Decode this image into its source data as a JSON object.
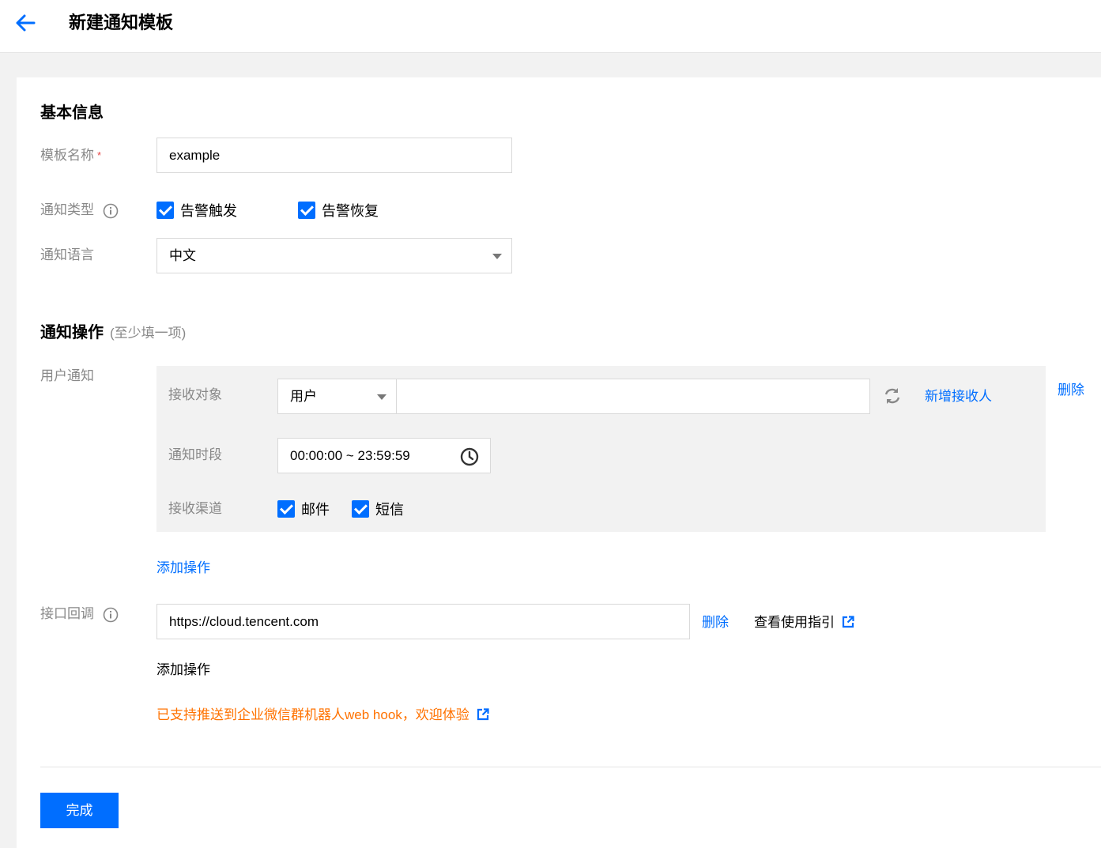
{
  "header": {
    "title": "新建通知模板"
  },
  "basic": {
    "section_title": "基本信息",
    "template_name_label": "模板名称",
    "required_mark": "*",
    "template_name_value": "example",
    "notify_type_label": "通知类型",
    "notify_types": [
      {
        "label": "告警触发",
        "checked": true
      },
      {
        "label": "告警恢复",
        "checked": true
      }
    ],
    "notify_lang_label": "通知语言",
    "notify_lang_value": "中文"
  },
  "actions": {
    "section_title": "通知操作",
    "section_sub": "(至少填一项)",
    "user_notify_label": "用户通知",
    "receiver_label": "接收对象",
    "receiver_type": "用户",
    "receiver_value": "",
    "add_receiver": "新增接收人",
    "delete_label": "删除",
    "period_label": "通知时段",
    "period_value": "00:00:00 ~ 23:59:59",
    "channel_label": "接收渠道",
    "channels": [
      {
        "label": "邮件",
        "checked": true
      },
      {
        "label": "短信",
        "checked": true
      }
    ],
    "add_action": "添加操作",
    "callback_label": "接口回调",
    "callback_value": "https://cloud.tencent.com",
    "callback_delete": "删除",
    "guide_label": "查看使用指引",
    "callback_add_action": "添加操作",
    "notice": "已支持推送到企业微信群机器人web hook，欢迎体验"
  },
  "footer": {
    "submit": "完成"
  },
  "colors": {
    "primary": "#006eff",
    "warning": "#ff7200",
    "panel": "#f2f2f2"
  }
}
